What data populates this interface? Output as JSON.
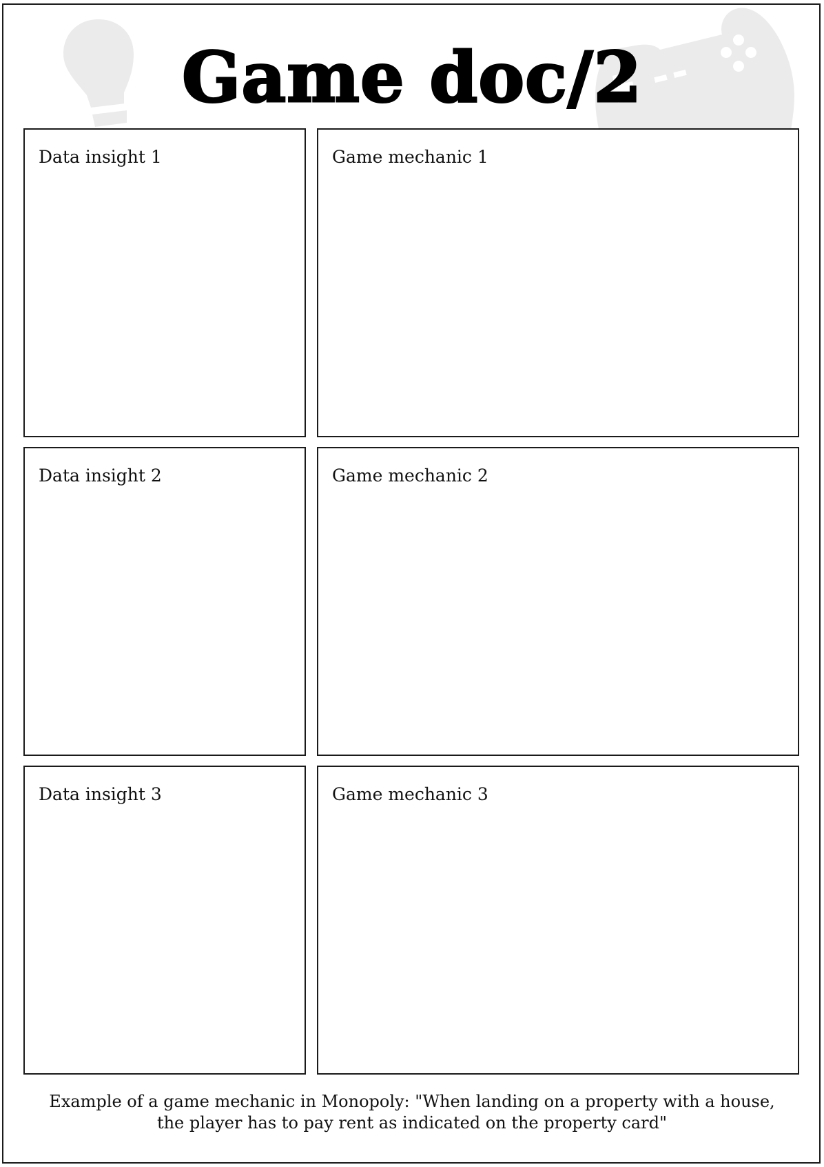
{
  "title": "Game doc/2",
  "icons": {
    "background_left": "lightbulb-icon",
    "background_right": "game-controller-icon",
    "icon_color": "#ebebeb"
  },
  "boxes": {
    "data_insights": [
      {
        "label": "Data insight 1"
      },
      {
        "label": "Data insight 2"
      },
      {
        "label": "Data insight 3"
      }
    ],
    "game_mechanics": [
      {
        "label": "Game mechanic 1"
      },
      {
        "label": "Game mechanic 2"
      },
      {
        "label": "Game mechanic 3"
      }
    ]
  },
  "footer": {
    "line1": "Example of a game mechanic in Monopoly: \"When landing on a property with a house,",
    "line2": "the player has to pay rent as indicated on the property card\""
  }
}
